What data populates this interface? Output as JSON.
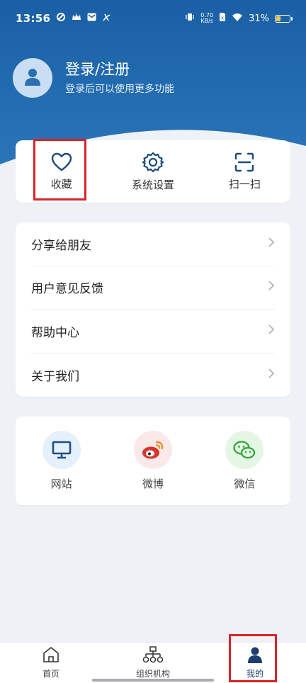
{
  "status_bar": {
    "time": "13:56",
    "speed_top": "0.70",
    "speed_bottom": "KB/s",
    "battery": "31%"
  },
  "profile": {
    "title": "登录/注册",
    "subtitle": "登录后可以使用更多功能"
  },
  "quick_actions": [
    {
      "label": "收藏",
      "icon": "heart-icon"
    },
    {
      "label": "系统设置",
      "icon": "gear-icon"
    },
    {
      "label": "扫一扫",
      "icon": "scan-icon"
    }
  ],
  "menu": [
    {
      "label": "分享给朋友"
    },
    {
      "label": "用户意见反馈"
    },
    {
      "label": "帮助中心"
    },
    {
      "label": "关于我们"
    }
  ],
  "social": [
    {
      "label": "网站",
      "icon": "monitor-icon",
      "bg": "#e5f0fb",
      "color": "#1f4f86"
    },
    {
      "label": "微博",
      "icon": "weibo-icon",
      "bg": "#fbe9e9",
      "color": "#d4372b"
    },
    {
      "label": "微信",
      "icon": "wechat-icon",
      "bg": "#e6f6e4",
      "color": "#2aa537"
    }
  ],
  "tabbar": [
    {
      "label": "首页",
      "icon": "home-icon"
    },
    {
      "label": "组织机构",
      "icon": "org-chart-icon"
    },
    {
      "label": "我的",
      "icon": "user-icon",
      "active": true
    }
  ],
  "colors": {
    "header_blue": "#1f63a6",
    "highlight_red": "#d8232a",
    "active_tab": "#1d3d6e"
  }
}
